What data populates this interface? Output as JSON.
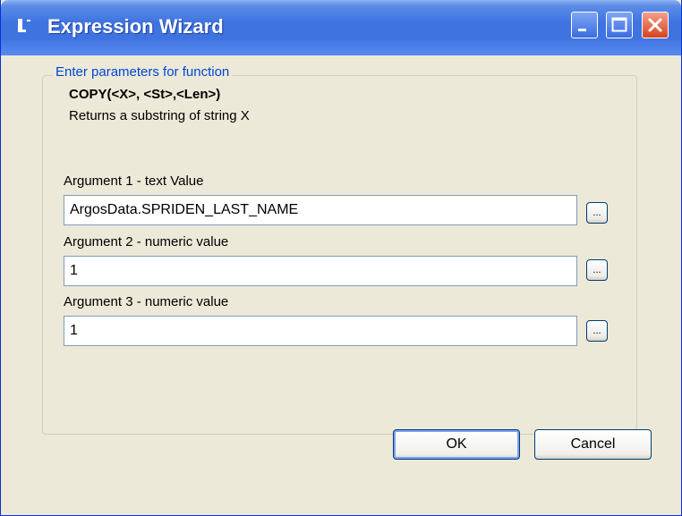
{
  "window": {
    "title": "Expression Wizard",
    "icons": {
      "app": "function-icon",
      "minimize": "minimize-icon",
      "maximize": "maximize-icon",
      "close": "close-icon"
    }
  },
  "group": {
    "legend": "Enter parameters for function",
    "function_signature": "COPY(<X>, <St>,<Len>)",
    "function_description": "Returns a substring of string X"
  },
  "arguments": [
    {
      "label": "Argument 1 - text Value",
      "value": "ArgosData.SPRIDEN_LAST_NAME",
      "browse_label": "..."
    },
    {
      "label": "Argument 2 - numeric value",
      "value": "1",
      "browse_label": "..."
    },
    {
      "label": "Argument 3 - numeric value",
      "value": "1",
      "browse_label": "..."
    }
  ],
  "buttons": {
    "ok": "OK",
    "cancel": "Cancel"
  },
  "colors": {
    "titlebar": "#3f74e0",
    "legend_text": "#0046d5",
    "dialog_bg": "#ece9d8",
    "close_button": "#d8421e"
  }
}
